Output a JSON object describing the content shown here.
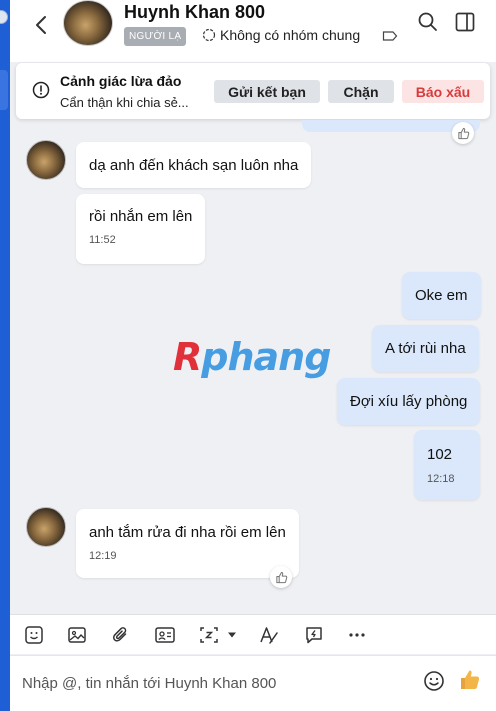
{
  "header": {
    "contact_name": "Huynh Khan 800",
    "stranger_badge": "NGƯỜI LẠ",
    "group_info": "Không có nhóm chung"
  },
  "warning": {
    "title": "Cảnh giác lừa đảo",
    "subtitle": "Cẩn thận khi chia sẻ...",
    "add_friend_label": "Gửi kết bạn",
    "block_label": "Chặn",
    "report_label": "Báo xấu"
  },
  "messages": [
    {
      "direction": "in",
      "text": "dạ anh đến khách sạn luôn nha",
      "time": ""
    },
    {
      "direction": "in",
      "text": "rồi nhắn em lên",
      "time": "11:52"
    },
    {
      "direction": "out",
      "text": "Oke em",
      "time": ""
    },
    {
      "direction": "out",
      "text": "A tới rùi nha",
      "time": ""
    },
    {
      "direction": "out",
      "text": "Đợi xíu lấy phòng",
      "time": ""
    },
    {
      "direction": "out",
      "text": "102",
      "time": "12:18"
    },
    {
      "direction": "in",
      "text": "anh tắm rửa đi nha rồi em lên",
      "time": "12:19"
    }
  ],
  "watermark": {
    "first": "R",
    "rest": "phang"
  },
  "composer": {
    "placeholder": "Nhập @, tin nhắn tới Huynh Khan 800"
  },
  "colors": {
    "accent": "#1f5fd6",
    "outgoing_bubble": "#dbe8fb",
    "report_text": "#d83b3b",
    "report_bg": "#fde4e4"
  }
}
